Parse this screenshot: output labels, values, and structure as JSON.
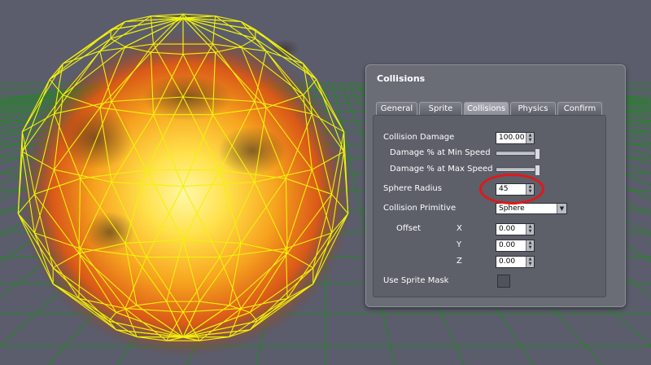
{
  "panel": {
    "title": "Collisions",
    "tabs": [
      {
        "label": "General",
        "active": false
      },
      {
        "label": "Sprite",
        "active": false
      },
      {
        "label": "Collisions",
        "active": true
      },
      {
        "label": "Physics",
        "active": false
      },
      {
        "label": "Confirm",
        "active": false
      }
    ],
    "fields": {
      "collision_damage": {
        "label": "Collision Damage",
        "value": "100.00"
      },
      "damage_min_speed": {
        "label": "Damage % at Min Speed",
        "level": 1.0
      },
      "damage_max_speed": {
        "label": "Damage % at Max Speed",
        "level": 1.0
      },
      "sphere_radius": {
        "label": "Sphere Radius",
        "value": "45"
      },
      "collision_primitive": {
        "label": "Collision Primitive",
        "value": "Sphere"
      },
      "offset": {
        "label": "Offset",
        "x": {
          "label": "X",
          "value": "0.00"
        },
        "y": {
          "label": "Y",
          "value": "0.00"
        },
        "z": {
          "label": "Z",
          "value": "0.00"
        }
      },
      "use_sprite_mask": {
        "label": "Use Sprite Mask",
        "checked": false
      }
    }
  },
  "colors": {
    "background": "#5b5d6c",
    "grid": "#1d8a1d",
    "wireframe": "#f2f20a",
    "explosion_core": "#ffe14a",
    "explosion_edge": "#e8580f",
    "highlight": "#e01818"
  },
  "icons": {
    "spin_up": "arrow-up-icon",
    "spin_down": "arrow-down-icon",
    "dropdown": "chevron-down-icon"
  }
}
